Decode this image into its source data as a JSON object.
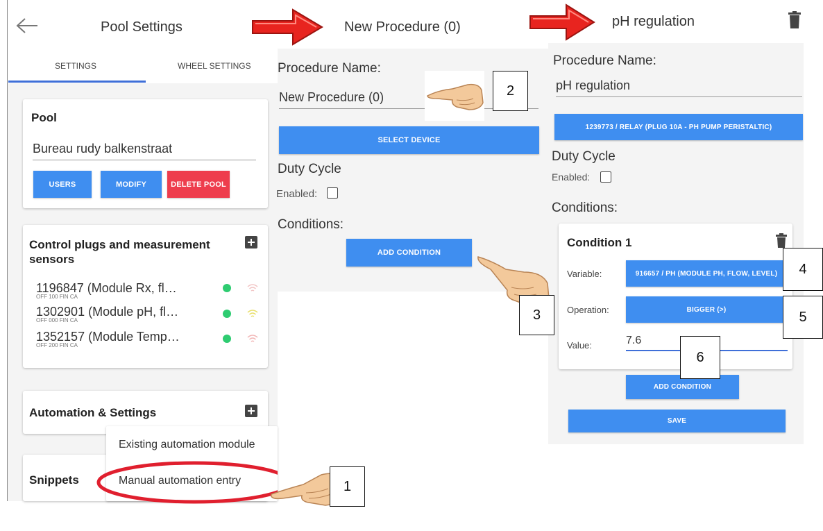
{
  "panel1": {
    "title": "Pool Settings",
    "tabs": [
      "SETTINGS",
      "WHEEL SETTINGS"
    ],
    "pool_card": {
      "heading": "Pool",
      "pool_name": "Bureau rudy balkenstraat",
      "buttons": {
        "users": "USERS",
        "modify": "MODIFY",
        "delete": "DELETE POOL"
      }
    },
    "devices_card": {
      "heading_line1": "Control plugs and measurement",
      "heading_line2": "sensors",
      "devices": [
        {
          "name": "1196847 (Module Rx, fl…",
          "sub": "OFF 100 FIN CA",
          "wifi_color": "#f2c6c6"
        },
        {
          "name": "1302901 (Module pH, fl…",
          "sub": "OFF 000 FIN CA",
          "wifi_color": "#e8df6a"
        },
        {
          "name": "1352157 (Module Temp…",
          "sub": "OFF 200 FIN CA",
          "wifi_color": "#f2b6b6"
        }
      ]
    },
    "automation_card": {
      "heading": "Automation & Settings"
    },
    "snippets_card": {
      "heading": "Snippets"
    },
    "menu": {
      "items": [
        "Existing automation module",
        "Manual automation entry"
      ]
    }
  },
  "panel2": {
    "title": "New Procedure (0)",
    "procedure_label": "Procedure Name:",
    "procedure_value": "New Procedure (0)",
    "select_device": "SELECT DEVICE",
    "duty_cycle": "Duty Cycle",
    "enabled_label": "Enabled:",
    "conditions": "Conditions:",
    "add_condition": "ADD CONDITION"
  },
  "panel3": {
    "title": "pH regulation",
    "procedure_label": "Procedure Name:",
    "procedure_value": "pH regulation",
    "device_button": "1239773 / RELAY (PLUG 10A - PH PUMP PERISTALTIC)",
    "duty_cycle": "Duty Cycle",
    "enabled_label": "Enabled:",
    "conditions": "Conditions:",
    "condition": {
      "heading": "Condition 1",
      "variable_label": "Variable:",
      "variable_value": "916657 / PH (MODULE PH, FLOW, LEVEL)",
      "operation_label": "Operation:",
      "operation_value": "BIGGER (>)",
      "value_label": "Value:",
      "value": "7.6"
    },
    "add_condition": "ADD CONDITION",
    "save": "SAVE"
  },
  "callouts": [
    "1",
    "2",
    "3",
    "4",
    "5",
    "6"
  ],
  "colors": {
    "accent_blue": "#3f8ef0",
    "danger_red": "#ee3d4d",
    "arrow_red": "#e8241f",
    "status_green": "#2ecc71"
  }
}
